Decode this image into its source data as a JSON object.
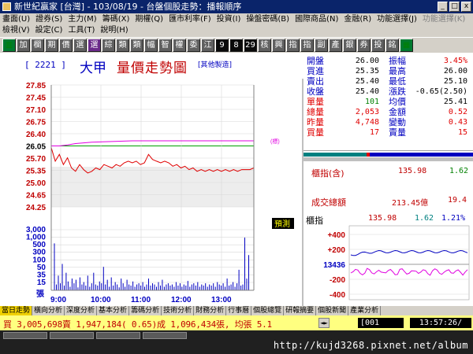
{
  "window": {
    "title": "新世紀贏家 [台灣] - 103/08/19 - 台盤個股走勢：播報順序",
    "controls": [
      "_",
      "□",
      "x"
    ]
  },
  "menu": {
    "row1": [
      {
        "label": "畫面(U)",
        "enabled": true
      },
      {
        "label": "證券(S)",
        "enabled": true
      },
      {
        "label": "主力(M)",
        "enabled": true
      },
      {
        "label": "籌碼(X)",
        "enabled": true
      },
      {
        "label": "期權(Q)",
        "enabled": true
      },
      {
        "label": "匯市利率(F)",
        "enabled": true
      },
      {
        "label": "投資(I)",
        "enabled": true
      },
      {
        "label": "操盤密碼(B)",
        "enabled": true
      },
      {
        "label": "國際商品(N)",
        "enabled": true
      },
      {
        "label": "金融(R)",
        "enabled": true
      },
      {
        "label": "功能選擇(J)",
        "enabled": true
      },
      {
        "label": "功能選擇(K)",
        "enabled": false
      }
    ],
    "row2": [
      {
        "label": "檢視(V)",
        "enabled": true
      },
      {
        "label": "設定(C)",
        "enabled": true
      },
      {
        "label": "工具(T)",
        "enabled": true
      },
      {
        "label": "說明(H)",
        "enabled": true
      }
    ]
  },
  "toolbar": {
    "buttons": [
      {
        "label": "▥",
        "style": "green"
      },
      {
        "label": "加",
        "style": "gray"
      },
      {
        "label": "欄",
        "style": "gray"
      },
      {
        "label": "期",
        "style": "gray"
      },
      {
        "label": "價",
        "style": "gray"
      },
      {
        "label": "選",
        "style": "gray"
      },
      {
        "label": "選",
        "style": "purple"
      },
      {
        "label": "綜",
        "style": "gray"
      },
      {
        "label": "類",
        "style": "gray"
      },
      {
        "label": "類",
        "style": "gray"
      },
      {
        "label": "幅",
        "style": "gray"
      },
      {
        "label": "智",
        "style": "gray"
      },
      {
        "label": "權",
        "style": "gray"
      },
      {
        "label": "委",
        "style": "gray"
      },
      {
        "label": "江",
        "style": "gray"
      },
      {
        "label": "9",
        "style": "num"
      },
      {
        "label": "8",
        "style": "num"
      },
      {
        "label": "29",
        "style": "num"
      },
      {
        "label": "核",
        "style": "gray"
      },
      {
        "label": "興",
        "style": "gray"
      },
      {
        "label": "指",
        "style": "gray"
      },
      {
        "label": "指",
        "style": "gray"
      },
      {
        "label": "副",
        "style": "gray"
      },
      {
        "label": "產",
        "style": "gray"
      },
      {
        "label": "銀",
        "style": "gray"
      },
      {
        "label": "券",
        "style": "gray"
      },
      {
        "label": "投",
        "style": "gray"
      },
      {
        "label": "銘",
        "style": "gray"
      },
      {
        "label": "▦",
        "style": "green"
      }
    ]
  },
  "stock": {
    "code": "[ 2221 ]",
    "name": "大甲",
    "chart_title": "量價走勢圖",
    "source": "[其他製造]"
  },
  "quote": [
    {
      "k1": "開盤",
      "v1": "26.00",
      "k2": "振幅",
      "v2": "3.45%",
      "v1c": "black",
      "v2c": "red",
      "k1c": "blue"
    },
    {
      "k1": "買進",
      "v1": "25.35",
      "k2": "最高",
      "v2": "26.00",
      "v1c": "black",
      "v2c": "black",
      "k1c": "blue"
    },
    {
      "k1": "賣出",
      "v1": "25.40",
      "k2": "最低",
      "v2": "25.10",
      "v1c": "black",
      "v2c": "black",
      "k1c": "blue"
    },
    {
      "k1": "收盤",
      "v1": "25.40",
      "k2": "漲跌",
      "v2": "-0.65(2.50)",
      "v1c": "black",
      "v2c": "black",
      "k1c": "black"
    },
    {
      "k1": "單量",
      "v1": "101",
      "k2": "均價",
      "v2": "25.41",
      "v1c": "green",
      "v2c": "black",
      "k1c": "red"
    },
    {
      "k1": "總量",
      "v1": "2,053",
      "k2": "金額",
      "v2": "0.52",
      "v1c": "red",
      "v2c": "red",
      "k1c": "red"
    },
    {
      "k1": "昨量",
      "v1": "4,748",
      "k2": "變動",
      "v2": "0.43",
      "v1c": "red",
      "v2c": "red",
      "k1c": "red"
    },
    {
      "k1": "買量",
      "v1": "17",
      "k2": "賣量",
      "v2": "15",
      "v1c": "red",
      "v2c": "red",
      "k1c": "red"
    }
  ],
  "index_panel": {
    "label1": "櫃指(含)",
    "value1": "135.98",
    "change1": "1.62",
    "label2": "成交總額",
    "value2": "213.45億",
    "change2": "19.4"
  },
  "mini_chart": {
    "label": "櫃指",
    "value": "135.98",
    "change": "1.62",
    "pct": "1.21%",
    "ticks": [
      "+400",
      "+200",
      "13436",
      "-200",
      "-400"
    ]
  },
  "chart_data": {
    "type": "line",
    "title": "量價走勢圖",
    "price_axis": {
      "labels": [
        "27.85",
        "27.45",
        "27.10",
        "26.75",
        "26.40",
        "26.05",
        "25.70",
        "25.35",
        "25.00",
        "24.65",
        "24.25"
      ],
      "range": [
        24.25,
        27.85
      ],
      "reference": 26.05
    },
    "volume_axis": {
      "labels": [
        "3,000",
        "1,000",
        "500",
        "300",
        "100",
        "50",
        "35",
        "15"
      ],
      "unit": "張"
    },
    "x_labels": [
      "9:00",
      "10:00",
      "11:00",
      "12:00",
      "13:00"
    ],
    "legend_right": "(標)",
    "forecast_label": "預測",
    "series": [
      {
        "name": "price",
        "color": "#e00000",
        "points": [
          [
            0,
            26.0
          ],
          [
            2,
            25.6
          ],
          [
            4,
            25.8
          ],
          [
            6,
            25.5
          ],
          [
            8,
            25.7
          ],
          [
            10,
            25.4
          ],
          [
            12,
            25.3
          ],
          [
            14,
            25.5
          ],
          [
            16,
            25.35
          ],
          [
            18,
            25.25
          ],
          [
            20,
            25.3
          ],
          [
            22,
            25.4
          ],
          [
            24,
            25.35
          ],
          [
            26,
            25.5
          ],
          [
            28,
            25.45
          ],
          [
            30,
            25.4
          ],
          [
            32,
            25.5
          ],
          [
            34,
            25.45
          ],
          [
            36,
            25.55
          ],
          [
            38,
            25.6
          ],
          [
            40,
            25.55
          ],
          [
            42,
            25.6
          ],
          [
            44,
            25.5
          ],
          [
            46,
            25.55
          ],
          [
            48,
            25.8
          ],
          [
            50,
            25.65
          ],
          [
            52,
            25.6
          ],
          [
            54,
            25.55
          ],
          [
            56,
            25.6
          ],
          [
            58,
            25.55
          ],
          [
            60,
            25.45
          ],
          [
            62,
            25.5
          ],
          [
            64,
            25.4
          ],
          [
            66,
            25.45
          ],
          [
            68,
            25.35
          ],
          [
            70,
            25.4
          ],
          [
            72,
            25.3
          ],
          [
            74,
            25.35
          ],
          [
            76,
            25.3
          ],
          [
            78,
            25.35
          ],
          [
            80,
            25.3
          ],
          [
            82,
            25.35
          ],
          [
            84,
            25.3
          ],
          [
            86,
            25.35
          ],
          [
            88,
            25.3
          ],
          [
            90,
            25.35
          ],
          [
            92,
            25.3
          ],
          [
            94,
            25.35
          ],
          [
            96,
            25.35
          ],
          [
            98,
            25.35
          ],
          [
            100,
            25.4
          ]
        ]
      },
      {
        "name": "average",
        "color": "#e000e0",
        "points": [
          [
            0,
            26.05
          ],
          [
            4,
            26.05
          ],
          [
            8,
            26.08
          ],
          [
            12,
            26.12
          ],
          [
            16,
            26.14
          ],
          [
            20,
            26.16
          ],
          [
            30,
            26.18
          ],
          [
            40,
            26.2
          ],
          [
            50,
            26.2
          ],
          [
            60,
            26.2
          ],
          [
            70,
            26.2
          ],
          [
            80,
            26.2
          ],
          [
            90,
            26.2
          ],
          [
            100,
            26.2
          ]
        ]
      }
    ],
    "volume_bars": [
      80,
      10,
      25,
      12,
      45,
      8,
      30,
      15,
      6,
      20,
      12,
      18,
      5,
      22,
      10,
      14,
      8,
      25,
      6,
      12,
      30,
      10,
      8,
      15,
      12,
      40,
      10,
      18,
      6,
      22,
      8,
      14,
      10,
      5,
      20,
      12,
      6,
      18,
      10,
      8,
      15,
      6,
      10,
      12,
      8,
      14,
      6,
      10,
      20,
      8,
      12,
      10,
      6,
      14,
      8,
      18,
      6,
      10,
      12,
      8,
      10,
      6,
      14,
      8,
      12,
      6,
      10,
      8,
      16,
      6,
      10,
      12,
      8,
      14,
      6,
      10,
      8,
      12,
      6,
      10,
      8,
      12,
      6,
      14,
      10,
      8,
      12,
      6,
      20,
      8,
      10,
      14,
      6,
      12,
      35,
      8,
      10,
      90,
      20,
      60
    ]
  },
  "tabs": [
    {
      "label": "當日走勢",
      "active": true
    },
    {
      "label": "橫向分析",
      "active": false
    },
    {
      "label": "深度分析",
      "active": false
    },
    {
      "label": "基本分析",
      "active": false
    },
    {
      "label": "籌碼分析",
      "active": false
    },
    {
      "label": "技術分析",
      "active": false
    },
    {
      "label": "財務分析",
      "active": false
    },
    {
      "label": "行事曆",
      "active": false
    },
    {
      "label": "個股總覽",
      "active": false
    },
    {
      "label": "研報摘要",
      "active": false
    },
    {
      "label": "個股新聞",
      "active": false
    },
    {
      "label": "產業分析",
      "active": false
    }
  ],
  "status": {
    "text": "買 3,005,698賣 1,947,184( 0.65)成 1,096,434張, 均張 5.1",
    "arrows": "◄►",
    "code": "[001",
    "time": "13:57:26/"
  },
  "watermark": {
    "url": "http://kujd3268.pixnet.net/album"
  }
}
